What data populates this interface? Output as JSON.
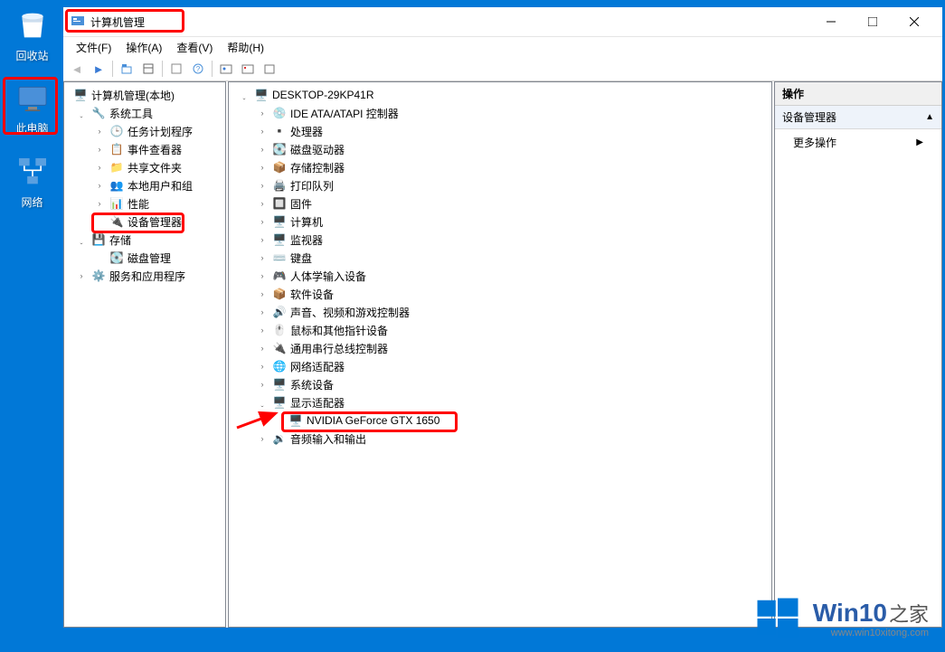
{
  "desktop": {
    "recycle": "回收站",
    "thispc": "此电脑",
    "network": "网络"
  },
  "window": {
    "title": "计算机管理",
    "menus": {
      "file": "文件(F)",
      "action": "操作(A)",
      "view": "查看(V)",
      "help": "帮助(H)"
    }
  },
  "left_tree": {
    "root": "计算机管理(本地)",
    "systools": "系统工具",
    "task": "任务计划程序",
    "event": "事件查看器",
    "shared": "共享文件夹",
    "users": "本地用户和组",
    "perf": "性能",
    "devmgr": "设备管理器",
    "storage": "存储",
    "diskmgr": "磁盘管理",
    "services": "服务和应用程序"
  },
  "mid_tree": {
    "computer": "DESKTOP-29KP41R",
    "ide": "IDE ATA/ATAPI 控制器",
    "cpu": "处理器",
    "diskdrv": "磁盘驱动器",
    "storagectl": "存储控制器",
    "printq": "打印队列",
    "firmware": "固件",
    "computers": "计算机",
    "monitor": "监视器",
    "keyboard": "键盘",
    "hid": "人体学输入设备",
    "softdev": "软件设备",
    "sound": "声音、视频和游戏控制器",
    "mouse": "鼠标和其他指针设备",
    "usb": "通用串行总线控制器",
    "netadapter": "网络适配器",
    "sysdev": "系统设备",
    "display": "显示适配器",
    "gpu": "NVIDIA GeForce GTX 1650",
    "audio": "音频输入和输出"
  },
  "actions": {
    "header": "操作",
    "sub": "设备管理器",
    "more": "更多操作"
  },
  "watermark": {
    "brand": "Win10",
    "suffix": "之家",
    "url": "www.win10xitong.com"
  }
}
